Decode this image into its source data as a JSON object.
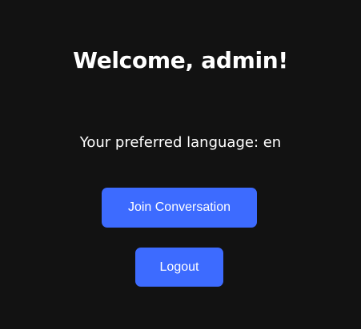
{
  "welcome": {
    "title": "Welcome, admin!"
  },
  "language": {
    "text": "Your preferred language: en"
  },
  "actions": {
    "join_label": "Join Conversation",
    "logout_label": "Logout"
  },
  "colors": {
    "background": "#121212",
    "button": "#3d6bff",
    "text": "#ffffff"
  }
}
